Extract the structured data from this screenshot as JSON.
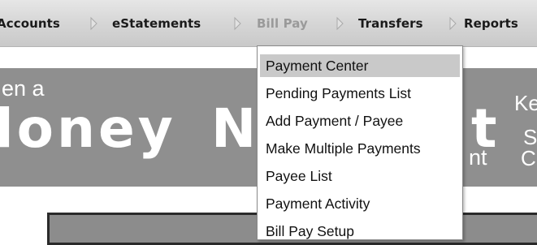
{
  "nav": {
    "items": [
      {
        "label": "Accounts",
        "active": false
      },
      {
        "label": "eStatements",
        "active": false
      },
      {
        "label": "Bill Pay",
        "active": true
      },
      {
        "label": "Transfers",
        "active": false
      },
      {
        "label": "Reports",
        "active": false
      }
    ],
    "separator_icon": "chevron-right-outline"
  },
  "banner": {
    "line1": "en a",
    "headline_left": "loney",
    "headline_mid": "N",
    "headline_right": "t",
    "line_under": "nt",
    "right_top": "Ke",
    "right_mid": "S",
    "right_bottom": "C"
  },
  "dropdown": {
    "items": [
      {
        "label": "Payment Center",
        "highlighted": true
      },
      {
        "label": "Pending Payments List",
        "highlighted": false
      },
      {
        "label": "Add Payment / Payee",
        "highlighted": false
      },
      {
        "label": "Make Multiple Payments",
        "highlighted": false
      },
      {
        "label": "Payee List",
        "highlighted": false
      },
      {
        "label": "Payment Activity",
        "highlighted": false
      },
      {
        "label": "Bill Pay Setup",
        "highlighted": false
      }
    ]
  },
  "colors": {
    "banner_bg": "#8f8f8f",
    "highlight": "#c9c9c9",
    "nav_active": "#9a9a9a"
  }
}
